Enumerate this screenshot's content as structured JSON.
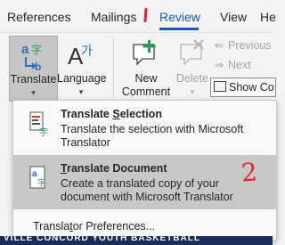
{
  "tabs": [
    {
      "label": "References",
      "active": false
    },
    {
      "label": "Mailings",
      "active": false
    },
    {
      "label": "Review",
      "active": true
    },
    {
      "label": "View",
      "active": false
    },
    {
      "label": "He",
      "active": false
    }
  ],
  "ribbon": {
    "translate": {
      "label": "Translate",
      "icon": "translate-icon"
    },
    "language": {
      "label": "Language",
      "icon": "language-icon"
    },
    "new_comment": {
      "label_line1": "New",
      "label_line2": "Comment",
      "icon": "new-comment-icon"
    },
    "delete": {
      "label": "Delete",
      "icon": "delete-comment-icon"
    },
    "previous": {
      "label": "Previous",
      "icon": "previous-comment-icon"
    },
    "next": {
      "label": "Next",
      "icon": "next-comment-icon"
    },
    "show_comments": {
      "label": "Show Co",
      "icon": "show-comments-icon"
    }
  },
  "menu": {
    "translate_selection": {
      "title_underlined": "S",
      "title_prefix": "Translate ",
      "title_suffix": "election",
      "description": "Translate the selection with Microsoft Translator"
    },
    "translate_document": {
      "title_prefix": "",
      "title_underlined": "T",
      "title_suffix": "ranslate Document",
      "description": "Create a translated copy of your document with Microsoft Translator"
    },
    "preferences": {
      "prefix": "Transla",
      "underlined": "t",
      "suffix": "or Preferences..."
    }
  },
  "annotations": {
    "mark_1": "1",
    "mark_2": "2"
  },
  "document_strip_text": "VILLE CONCORD YOUTH BASKETBALL",
  "colors": {
    "accent": "#185abd",
    "annotation": "#e8232a",
    "selected_bg": "#c8c8c8",
    "translate_btn_bg": "#c6c6c6"
  }
}
